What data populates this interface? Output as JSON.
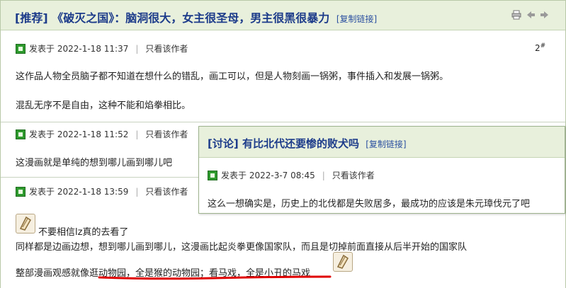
{
  "thread": {
    "title_prefix": "[推荐]",
    "title": "《破灭之国》：脑洞很大，女主很圣母，男主很黑很暴力",
    "copy_link": "[复制链接]",
    "tools": [
      "print-icon",
      "prev-icon",
      "next-icon"
    ]
  },
  "posts": [
    {
      "posted_prefix": "发表于",
      "time": "2022-1-18 11:37",
      "author_only": "只看该作者",
      "floor": "2",
      "floor_mark": "#",
      "lines": [
        "这作品人物全员脑子都不知道在想什么的错乱，画工可以，但是人物刻画一锅粥，事件插入和发展一锅粥。",
        "混乱无序不是自由，这种不能和焰拳相比。"
      ]
    },
    {
      "posted_prefix": "发表于",
      "time": "2022-1-18 11:52",
      "author_only": "只看该作者",
      "lines": [
        "这漫画就是单纯的想到哪儿画到哪儿吧"
      ]
    },
    {
      "posted_prefix": "发表于",
      "time": "2022-1-18 13:59",
      "author_only": "只看该作者",
      "lines": [
        "不要相信lz真的去看了",
        "同样都是边画边想，想到哪儿画到哪儿，这漫画比起炎拳更像国家队，而且是切掉前面直接从后半开始的国家队",
        "整部漫画观感就像逛动物园，全是猴的动物园；看马戏，全是小丑的马戏"
      ]
    }
  ],
  "popup": {
    "title_prefix": "[讨论]",
    "title": "有比北代还要惨的败犬吗",
    "copy_link": "[复制链接]",
    "posted_prefix": "发表于",
    "time": "2022-3-7 08:45",
    "author_only": "只看该作者",
    "text": "这么一想确实是，历史上的北伐都是失败居多，最成功的应该是朱元璋伐元了吧"
  },
  "colors": {
    "title": "#1c3b8a",
    "header_bg": "#e8f0dc",
    "underline": "#e00000"
  }
}
